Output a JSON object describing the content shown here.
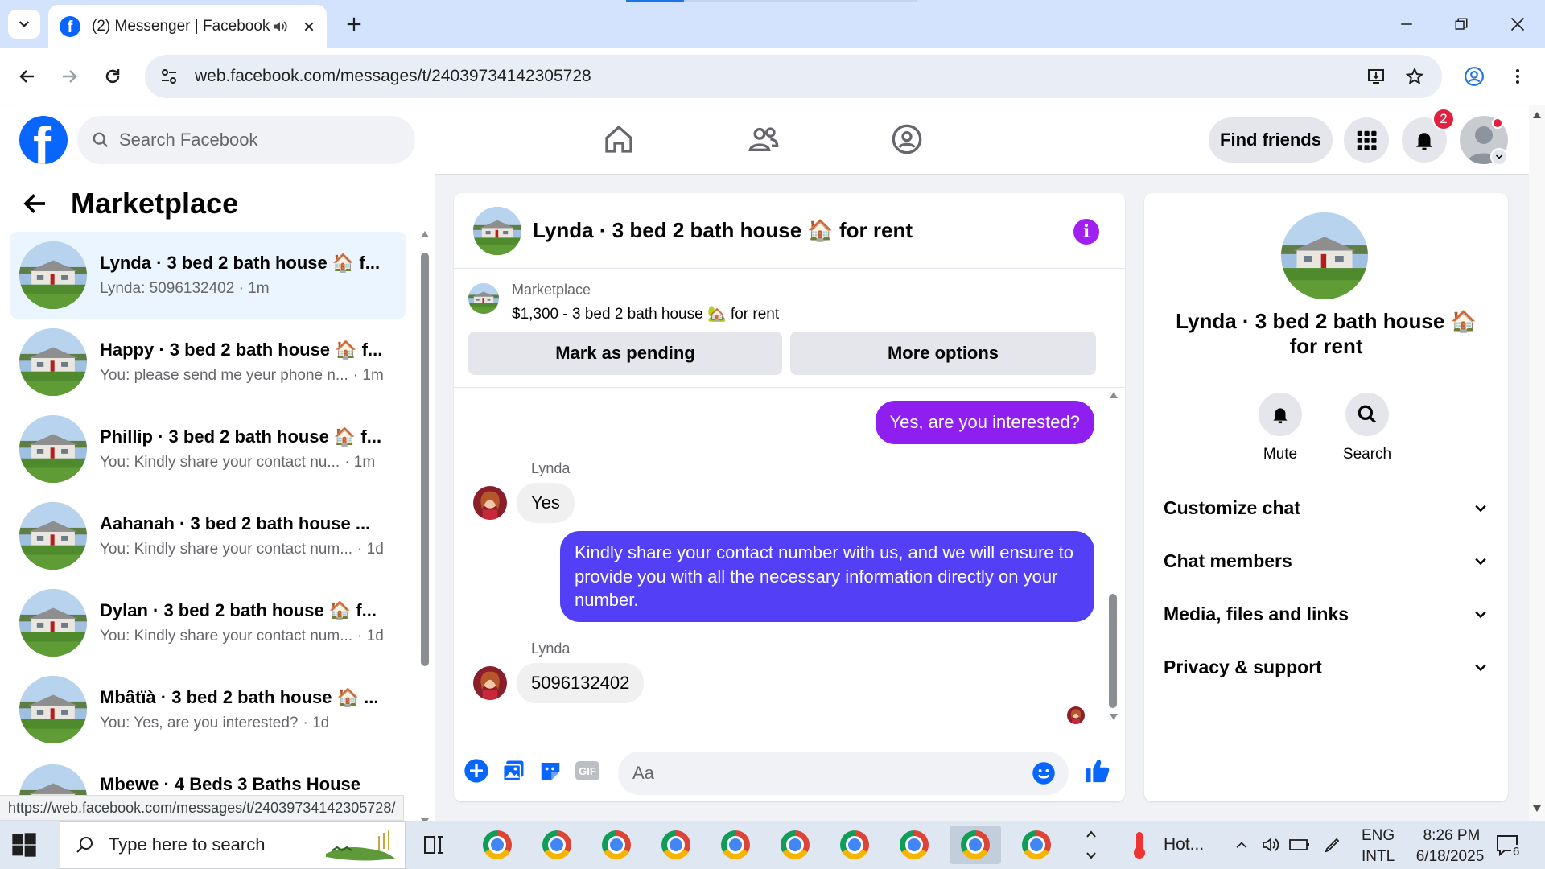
{
  "browser": {
    "tab_title": "(2) Messenger | Facebook",
    "url": "web.facebook.com/messages/t/24039734142305728",
    "status_url": "https://web.facebook.com/messages/t/24039734142305728/"
  },
  "header": {
    "search_placeholder": "Search Facebook",
    "find_friends": "Find friends",
    "notification_count": "2"
  },
  "left": {
    "title": "Marketplace",
    "conversations": [
      {
        "name": "Lynda · 3 bed 2 bath house 🏠 f...",
        "preview": "Lynda: 5096132402 · 1m",
        "time": ""
      },
      {
        "name": "Happy · 3 bed 2 bath house 🏠 f...",
        "preview": "You: please send me yeur phone n...",
        "time": "· 1m"
      },
      {
        "name": "Phillip · 3 bed 2 bath house 🏠 f...",
        "preview": "You: Kindly share your contact nu...",
        "time": "· 1m"
      },
      {
        "name": "Aahanah · 3 bed 2 bath house ...",
        "preview": "You: Kindly share your contact num...",
        "time": "· 1d"
      },
      {
        "name": "Dylan · 3 bed 2 bath house 🏠 f...",
        "preview": "You: Kindly share your contact num...",
        "time": "· 1d"
      },
      {
        "name": "Mbâtïà · 3 bed 2 bath house 🏠 ...",
        "preview": "You: Yes, are you interested?",
        "time": "· 1d"
      },
      {
        "name": "Mbewe · 4 Beds 3 Baths House",
        "preview": "",
        "time": ""
      }
    ]
  },
  "chat": {
    "title": "Lynda · 3 bed 2 bath house 🏠 for rent",
    "marketplace_label": "Marketplace",
    "listing": "$1,300 - 3 bed 2 bath house 🏡 for rent",
    "mark_pending": "Mark as pending",
    "more_options": "More options",
    "messages": [
      {
        "from": "me",
        "text": "Yes, are you interested?"
      },
      {
        "from": "Lynda",
        "sender": "Lynda",
        "text": "Yes"
      },
      {
        "from": "me",
        "text": "Kindly share your contact number with us, and we will ensure to provide you with all the necessary information directly on your number."
      },
      {
        "from": "Lynda",
        "sender": "Lynda",
        "text": "5096132402"
      }
    ],
    "composer_placeholder": "Aa"
  },
  "right": {
    "title": "Lynda · 3 bed 2 bath house 🏠 for rent",
    "mute": "Mute",
    "search": "Search",
    "sections": [
      "Customize chat",
      "Chat members",
      "Media, files and links",
      "Privacy & support"
    ]
  },
  "taskbar": {
    "search_placeholder": "Type here to search",
    "weather": "Hot...",
    "lang1": "ENG",
    "lang2": "INTL",
    "time": "8:26 PM",
    "date": "6/18/2025",
    "notifications": "6"
  },
  "colors": {
    "facebook_blue": "#0866ff",
    "messenger_purple": "#a020f0",
    "bubble_purple": "#8f1ef0",
    "bubble_blue": "#5340f6",
    "active_convo": "#ebf5ff"
  }
}
